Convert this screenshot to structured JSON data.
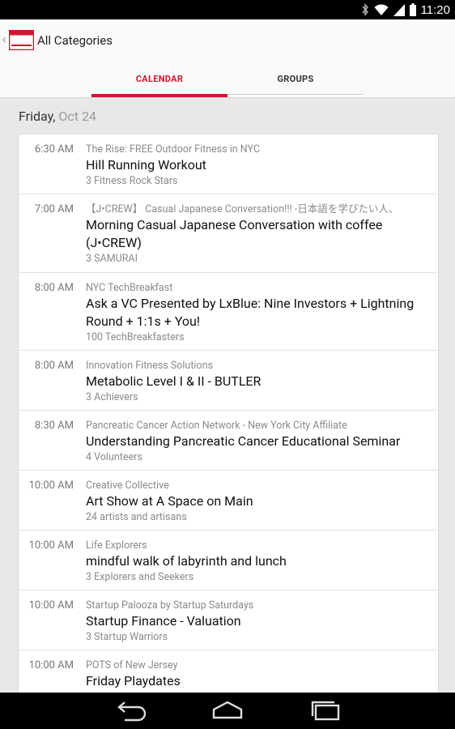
{
  "status": {
    "time": "11:20"
  },
  "actionbar": {
    "title": "All Categories"
  },
  "tabs": [
    {
      "label": "CALENDAR",
      "selected": true
    },
    {
      "label": "GROUPS",
      "selected": false
    }
  ],
  "date": {
    "day": "Friday,",
    "date": "Oct 24"
  },
  "events": [
    {
      "time": "6:30 AM",
      "group": "The Rise: FREE Outdoor Fitness in NYC",
      "title": "Hill Running Workout",
      "attendees": "3 Fitness Rock Stars"
    },
    {
      "time": "7:00 AM",
      "group": "【J•CREW】 Casual Japanese Conversation!!! -日本語を学びたい人、",
      "title": "Morning Casual Japanese Conversation with coffee (J•CREW)",
      "attendees": "3 SAMURAI"
    },
    {
      "time": "8:00 AM",
      "group": "NYC TechBreakfast",
      "title": "Ask a VC Presented by LxBlue: Nine Investors + Lightning Round + 1:1s + You!",
      "attendees": "100 TechBreakfasters"
    },
    {
      "time": "8:00 AM",
      "group": "Innovation Fitness Solutions",
      "title": "Metabolic Level I & II - BUTLER",
      "attendees": "3 Achievers"
    },
    {
      "time": "8:30 AM",
      "group": "Pancreatic Cancer Action Network - New York City  Affiliate",
      "title": "Understanding Pancreatic Cancer Educational Seminar",
      "attendees": "4 Volunteers"
    },
    {
      "time": "10:00 AM",
      "group": "Creative Collective",
      "title": "Art Show at A Space on Main",
      "attendees": "24 artists and artisans"
    },
    {
      "time": "10:00 AM",
      "group": "Life Explorers",
      "title": "mindful walk of labyrinth and lunch",
      "attendees": "3 Explorers and Seekers"
    },
    {
      "time": "10:00 AM",
      "group": "Startup Palooza by Startup Saturdays",
      "title": "Startup Finance - Valuation",
      "attendees": "3 Startup Warriors"
    },
    {
      "time": "10:00 AM",
      "group": "POTS of New Jersey",
      "title": "Friday Playdates",
      "attendees": ""
    }
  ],
  "colors": {
    "accent": "#d0142e"
  },
  "icons": [
    "bluetooth-icon",
    "wifi-icon",
    "signal-icon",
    "battery-icon",
    "back-icon",
    "home-icon",
    "recents-icon"
  ]
}
